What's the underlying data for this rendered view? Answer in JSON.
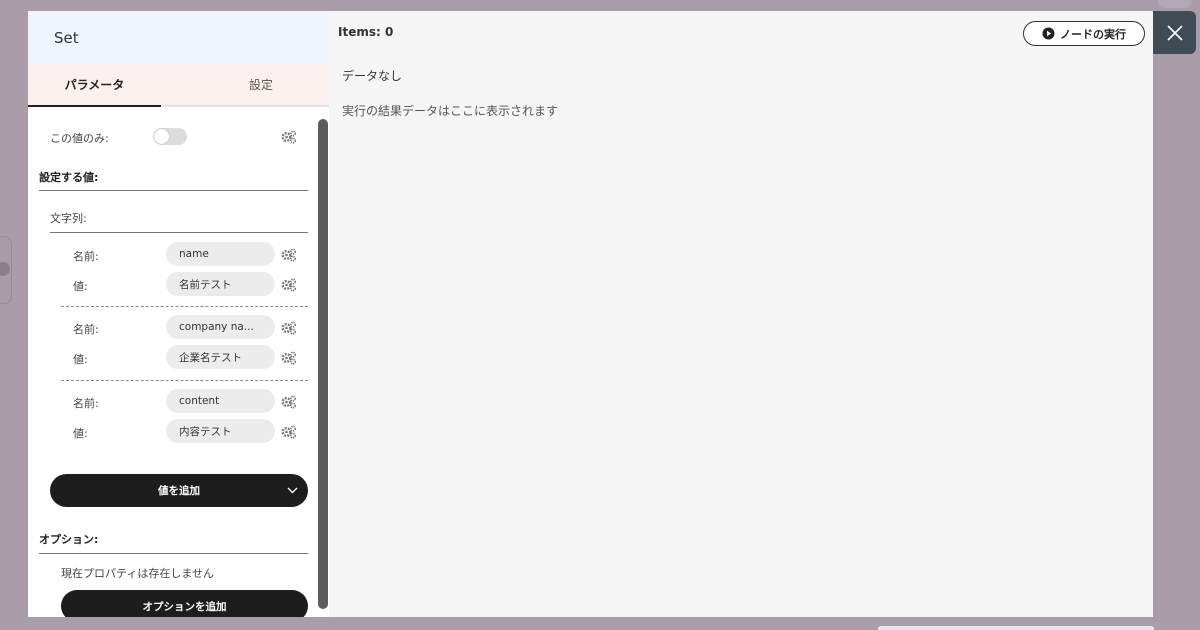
{
  "modal": {
    "title": "Set",
    "tabs": [
      {
        "label": "パラメータ",
        "active": true
      },
      {
        "label": "設定",
        "active": false
      }
    ],
    "only_this_value_label": "この値のみ:",
    "only_this_value_on": false,
    "values_section_title": "設定する値:",
    "string_section_label": "文字列:",
    "entries": [
      {
        "name_label": "名前:",
        "name_value": "name",
        "value_label": "値:",
        "value_value": "名前テスト"
      },
      {
        "name_label": "名前:",
        "name_value": "company na...",
        "value_label": "値:",
        "value_value": "企業名テスト"
      },
      {
        "name_label": "名前:",
        "name_value": "content",
        "value_label": "値:",
        "value_value": "内容テスト"
      }
    ],
    "add_value_button": "値を追加",
    "options_title": "オプション:",
    "no_properties_text": "現在プロパティは存在しません",
    "add_option_button": "オプションを追加"
  },
  "output": {
    "items_label": "Items: 0",
    "run_button": "ノードの実行",
    "no_data_title": "データなし",
    "result_hint": "実行の結果データはここに表示されます"
  },
  "colors": {
    "overlay": "#a99daa",
    "header_bg": "#eff4fd",
    "tabs_bg": "#fdf1ef",
    "close_bg": "#3f4b55",
    "button_dark": "#1d1d1d"
  },
  "icons": [
    "settings-gear-icon",
    "close-icon",
    "chevron-down-icon",
    "play-circle-icon"
  ]
}
